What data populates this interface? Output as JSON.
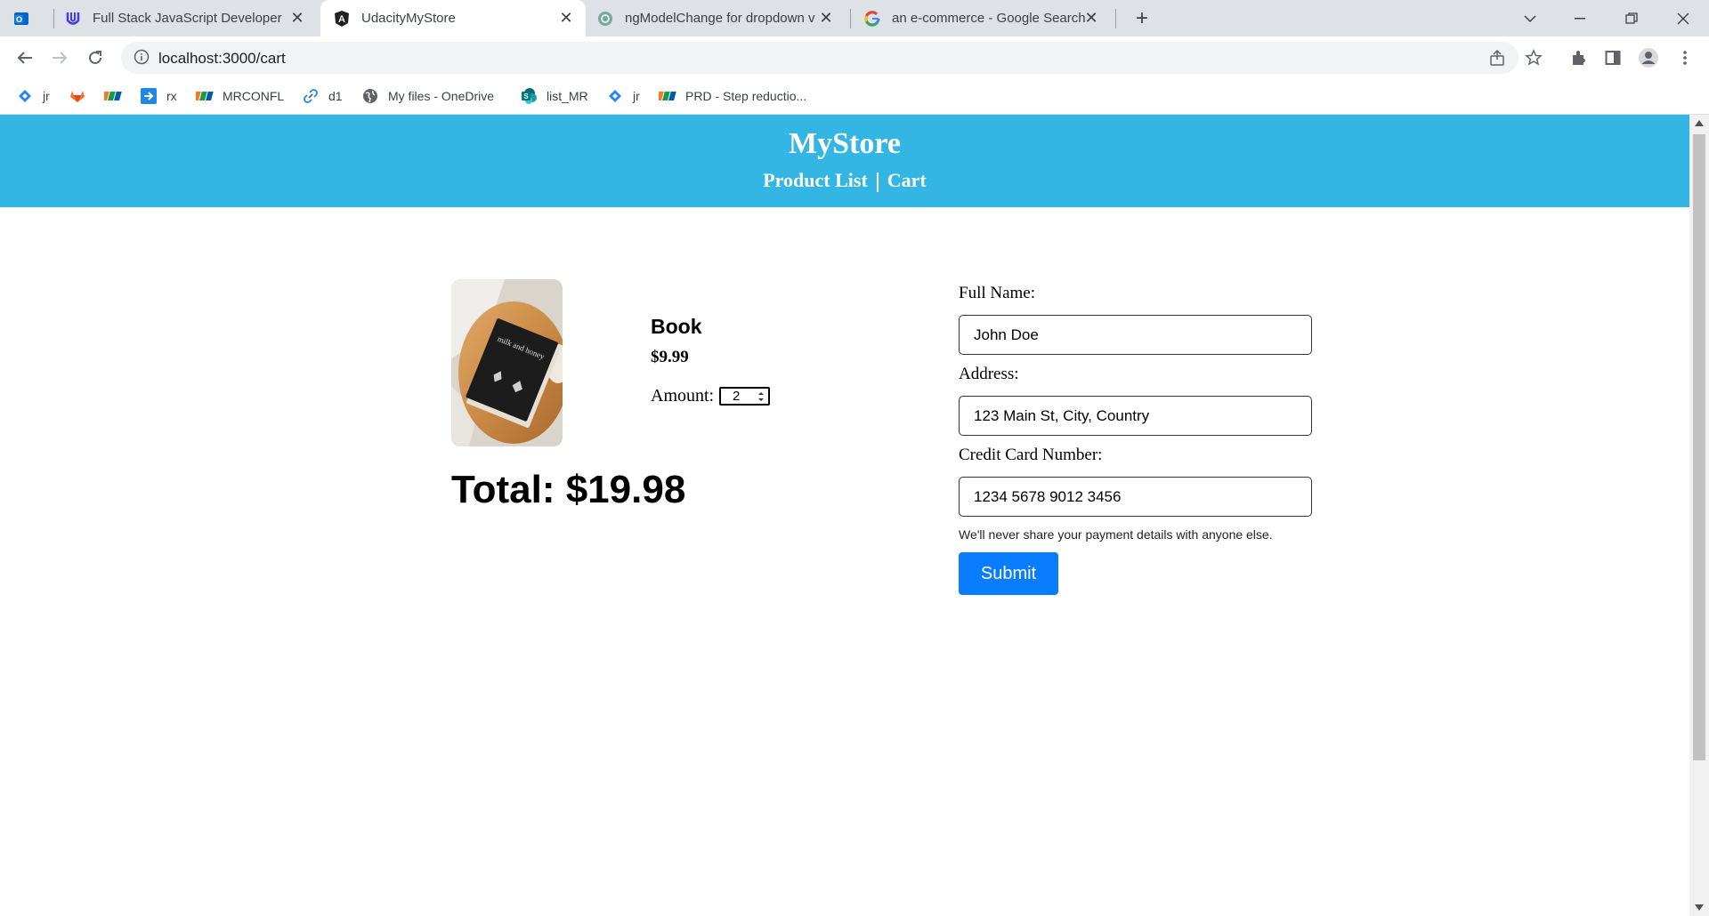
{
  "browser": {
    "tabs": [
      {
        "title": "",
        "icon": "outlook-icon"
      },
      {
        "title": "Full Stack JavaScript Developer",
        "icon": "udacity-icon"
      },
      {
        "title": "UdacityMyStore",
        "icon": "angular-icon",
        "active": true
      },
      {
        "title": "ngModelChange for dropdown v",
        "icon": "chatgpt-icon"
      },
      {
        "title": "an e-commerce - Google Search",
        "icon": "google-icon"
      }
    ],
    "url": "localhost:3000/cart",
    "bookmarks": [
      {
        "label": "jr",
        "icon": "jira-icon"
      },
      {
        "label": "",
        "icon": "gitlab-icon"
      },
      {
        "label": "",
        "icon": "fpt-icon"
      },
      {
        "label": "rx",
        "icon": "arrow-icon"
      },
      {
        "label": "MRCONFL",
        "icon": "fpt-icon"
      },
      {
        "label": "d1",
        "icon": "link-icon"
      },
      {
        "label": "My files - OneDrive",
        "icon": "globe-icon"
      },
      {
        "label": "list_MR",
        "icon": "sharepoint-icon"
      },
      {
        "label": "jr",
        "icon": "jira-icon"
      },
      {
        "label": "PRD - Step reductio...",
        "icon": "fpt-icon"
      }
    ]
  },
  "header": {
    "brand": "MyStore",
    "nav": {
      "product_list": "Product List",
      "cart": "Cart"
    },
    "color": "#34b6e4"
  },
  "cart": {
    "item": {
      "name": "Book",
      "price": "$9.99",
      "amount_label": "Amount:",
      "amount_value": "2",
      "image_text": "milk and honey"
    },
    "total": "Total: $19.98"
  },
  "form": {
    "full_name_label": "Full Name:",
    "full_name_value": "John Doe",
    "address_label": "Address:",
    "address_value": "123 Main St, City, Country",
    "card_label": "Credit Card Number:",
    "card_value": "1234 5678 9012 3456",
    "hint": "We'll never share your payment details with anyone else.",
    "submit_label": "Submit",
    "submit_color": "#0a7cff"
  }
}
